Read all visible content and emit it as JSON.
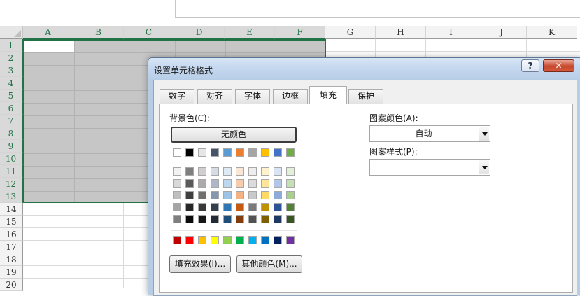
{
  "sheet": {
    "columns": [
      "A",
      "B",
      "C",
      "D",
      "E",
      "F",
      "G",
      "H",
      "I",
      "J",
      "K"
    ],
    "rows": [
      "1",
      "2",
      "3",
      "4",
      "5",
      "6",
      "7",
      "8",
      "9",
      "10",
      "11",
      "12",
      "13",
      "14",
      "15",
      "16",
      "17",
      "18",
      "19",
      "20"
    ]
  },
  "dialog": {
    "title": "设置单元格格式",
    "help_label": "?",
    "close_label": "✕",
    "tabs": [
      "数字",
      "对齐",
      "字体",
      "边框",
      "填充",
      "保护"
    ],
    "active_tab": "填充",
    "background_color_label": "背景色(C):",
    "no_color_label": "无颜色",
    "pattern_color_label": "图案颜色(A):",
    "pattern_color_value": "自动",
    "pattern_style_label": "图案样式(P):",
    "pattern_style_value": "",
    "fill_effects_label": "填充效果(I)...",
    "more_colors_label": "其他颜色(M)...",
    "theme_top_colors": [
      "#ffffff",
      "#000000",
      "#e7e6e6",
      "#44546a",
      "#5b9bd5",
      "#ed7d31",
      "#a5a5a5",
      "#ffc000",
      "#4472c4",
      "#70ad47"
    ],
    "theme_shades": [
      [
        "#f2f2f2",
        "#7f7f7f",
        "#d0cece",
        "#d6dce4",
        "#deebf6",
        "#fbe5d5",
        "#ededed",
        "#fff2cc",
        "#dae3f3",
        "#e2efd9"
      ],
      [
        "#d8d8d8",
        "#595959",
        "#aeaaaa",
        "#adb9ca",
        "#bdd7ee",
        "#f7cbac",
        "#dbdbdb",
        "#fee599",
        "#b4c6e7",
        "#c5e0b3"
      ],
      [
        "#bfbfbf",
        "#3f3f3f",
        "#757070",
        "#8496b0",
        "#9dc3e6",
        "#f4b183",
        "#c9c9c9",
        "#ffd965",
        "#8eaadb",
        "#a8d08d"
      ],
      [
        "#a5a5a5",
        "#262626",
        "#3a3838",
        "#323f4f",
        "#2e75b5",
        "#c55a11",
        "#7b7b7b",
        "#bf9000",
        "#2f5496",
        "#538135"
      ],
      [
        "#7f7f7f",
        "#0c0c0c",
        "#171616",
        "#222a35",
        "#1e4e79",
        "#833c0b",
        "#525252",
        "#7f6000",
        "#1f3864",
        "#375623"
      ]
    ],
    "standard_colors": [
      "#c00000",
      "#ff0000",
      "#ffc000",
      "#ffff00",
      "#92d050",
      "#00b050",
      "#00b0f0",
      "#0070c0",
      "#002060",
      "#7030a0"
    ]
  }
}
